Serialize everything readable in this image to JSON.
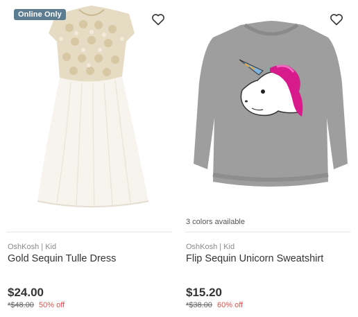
{
  "products": [
    {
      "badge": "Online Only",
      "colors": "",
      "brand": "OshKosh | Kid",
      "title": "Gold Sequin Tulle Dress",
      "price": "$24.00",
      "original_price": "*$48.00",
      "discount": "50% off"
    },
    {
      "badge": "",
      "colors": "3 colors available",
      "brand": "OshKosh | Kid",
      "title": "Flip Sequin Unicorn Sweatshirt",
      "price": "$15.20",
      "original_price": "*$38.00",
      "discount": "60% off"
    }
  ],
  "colors": {
    "badge": "#5c7c8f",
    "discount": "#d9534f",
    "divider": "#e5e5e5"
  }
}
